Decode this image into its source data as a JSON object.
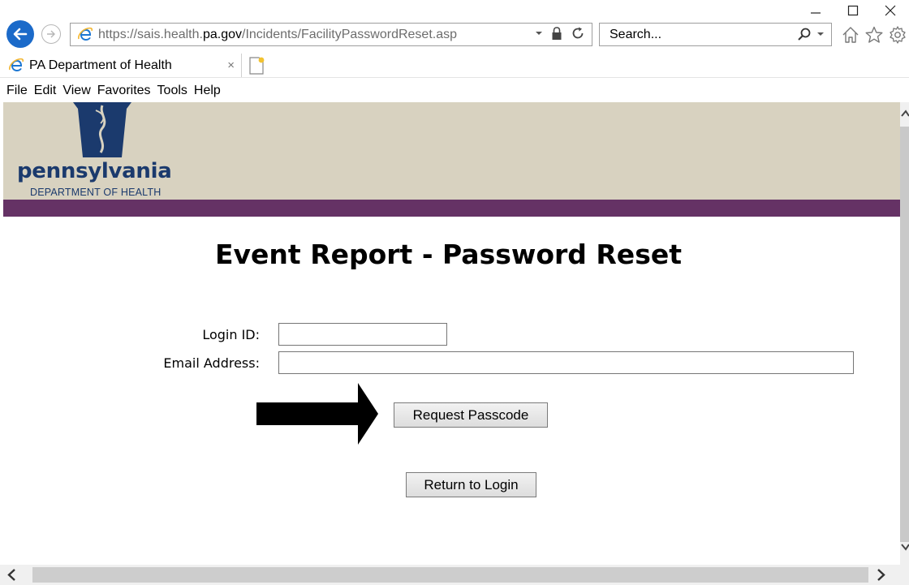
{
  "browser": {
    "url_scheme": "https://sais.health.",
    "url_domain": "pa.gov",
    "url_path": "/Incidents/FacilityPasswordReset.asp",
    "search_placeholder": "Search...",
    "tab_title": "PA Department of Health",
    "tab_close": "×",
    "menu": [
      "File",
      "Edit",
      "View",
      "Favorites",
      "Tools",
      "Help"
    ],
    "icons": {
      "back": "back-arrow-icon",
      "forward": "forward-arrow-icon",
      "ie": "internet-explorer-icon",
      "lock": "lock-icon",
      "refresh": "refresh-icon",
      "search": "search-icon",
      "home": "home-icon",
      "favorites": "star-icon",
      "settings": "gear-icon",
      "new_tab": "new-tab-icon"
    },
    "colors": {
      "back_button": "#1b6ac9",
      "ie_blue": "#1b76d2"
    }
  },
  "site": {
    "logo_text": "pennsylvania",
    "logo_subtext": "DEPARTMENT OF HEALTH",
    "colors": {
      "header_bg": "#d8d2c0",
      "band": "#653265",
      "logo_blue": "#1b3a6d"
    }
  },
  "page": {
    "title": "Event Report - Password Reset",
    "form": {
      "login_label": "Login ID:",
      "login_value": "",
      "email_label": "Email Address:",
      "email_value": ""
    },
    "buttons": {
      "request": "Request Passcode",
      "return": "Return to Login"
    },
    "annotation": "arrow-pointer-icon"
  }
}
